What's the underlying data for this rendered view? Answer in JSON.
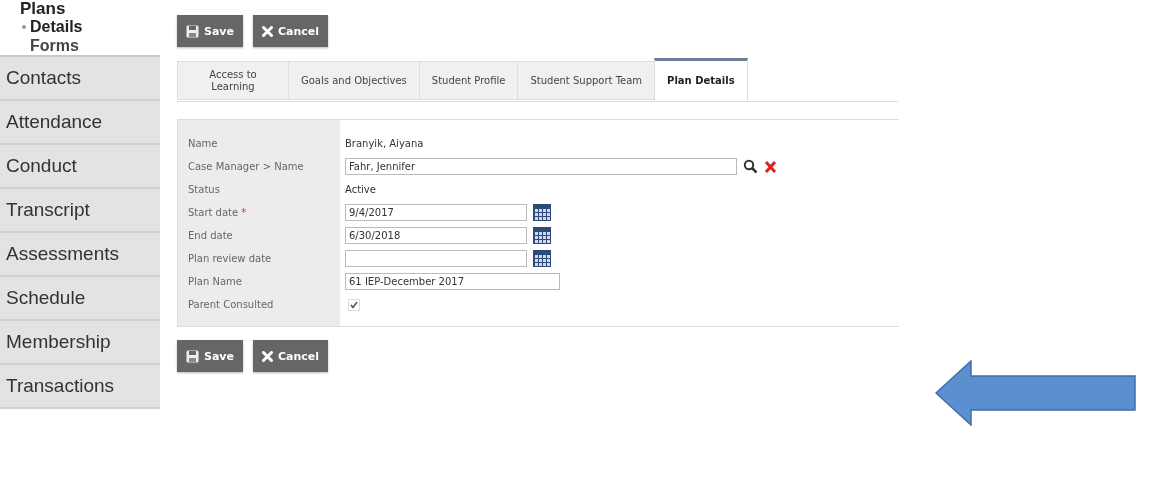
{
  "sidebar": {
    "heading": "Plans",
    "subitems": [
      {
        "label": "Details",
        "selected": true
      },
      {
        "label": "Forms",
        "selected": false
      }
    ],
    "items": [
      {
        "label": "Contacts",
        "selected": false
      },
      {
        "label": "Attendance",
        "selected": false
      },
      {
        "label": "Conduct",
        "selected": false
      },
      {
        "label": "Transcript",
        "selected": false
      },
      {
        "label": "Assessments",
        "selected": false
      },
      {
        "label": "Schedule",
        "selected": false
      },
      {
        "label": "Membership",
        "selected": false
      },
      {
        "label": "Transactions",
        "selected": false
      }
    ]
  },
  "top_buttons": [
    {
      "kind": "save",
      "label": "Save"
    },
    {
      "kind": "cancel",
      "label": "Cancel"
    }
  ],
  "tabs": [
    {
      "label": "Access to Learning",
      "selected": false
    },
    {
      "label": "Goals and Objectives",
      "selected": false
    },
    {
      "label": "Student Profile",
      "selected": false
    },
    {
      "label": "Student Support Team",
      "selected": false
    },
    {
      "label": "Plan Details",
      "selected": true
    }
  ],
  "form": [
    {
      "kind": "text",
      "label": "Name",
      "value": "Branyik, Aiyana"
    },
    {
      "kind": "lookup",
      "label": "Case Manager > Name",
      "value": "Fahr, Jennifer"
    },
    {
      "kind": "text",
      "label": "Status",
      "value": "Active"
    },
    {
      "kind": "date",
      "label": "Start date",
      "required_mark": "*",
      "value": "9/4/2017"
    },
    {
      "kind": "date",
      "label": "End date",
      "value": "6/30/2018"
    },
    {
      "kind": "date",
      "label": "Plan review date"
    },
    {
      "kind": "input",
      "label": "Plan Name",
      "value": "61 IEP-December 2017"
    },
    {
      "kind": "checkbox",
      "label": "Parent Consulted",
      "checked": true
    }
  ],
  "bottom_buttons": [
    {
      "kind": "save",
      "label": "Save"
    },
    {
      "kind": "cancel",
      "label": "Cancel"
    }
  ]
}
